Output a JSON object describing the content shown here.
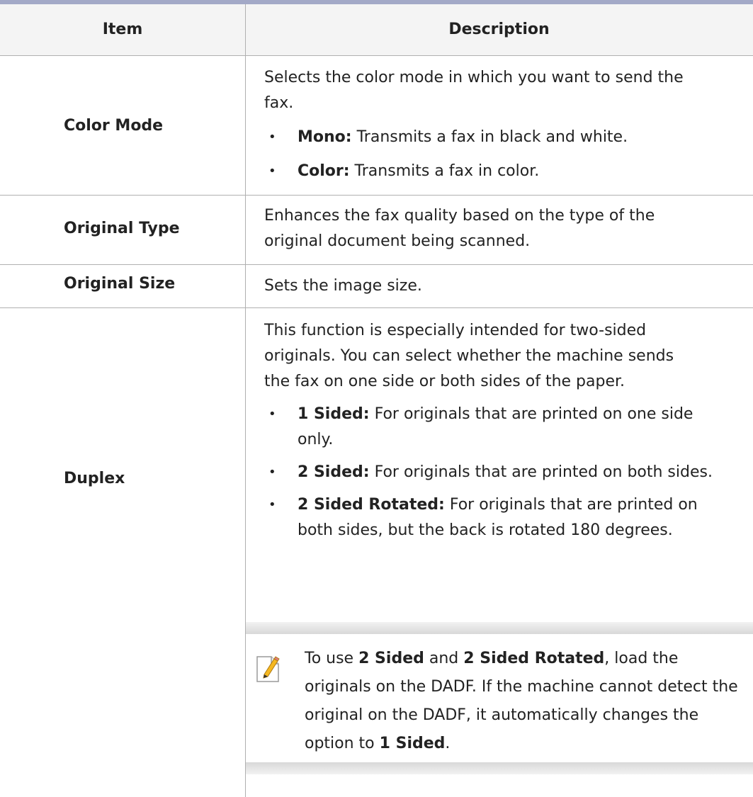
{
  "table": {
    "header": {
      "item": "Item",
      "description": "Description"
    },
    "rows": [
      {
        "item": "Color Mode",
        "desc_line1": "Selects the color mode in which you want to send the",
        "desc_line2": "fax.",
        "bullets": [
          {
            "label": "Mono:",
            "text": " Transmits a fax in black and white."
          },
          {
            "label": "Color:",
            "text": " Transmits a fax in color."
          }
        ]
      },
      {
        "item": "Original Type",
        "desc_line1": "Enhances the fax quality based on the type of the",
        "desc_line2": "original document being scanned."
      },
      {
        "item": "Original Size",
        "desc_line1": "Sets the image size."
      },
      {
        "item": "Duplex",
        "desc_line1": "This function is especially intended for two-sided",
        "desc_line2": "originals. You can select whether the machine sends",
        "desc_line3": "the fax on one side or both sides of the paper.",
        "bullets": [
          {
            "label": "1 Sided:",
            "text": " For originals that are printed on one side",
            "text2": "only."
          },
          {
            "label": "2 Sided:",
            "text": " For originals that are printed on both sides."
          },
          {
            "label": "2 Sided Rotated:",
            "text": " For originals that are printed on",
            "text2": "both sides, but the back is rotated 180 degrees."
          }
        ],
        "note": {
          "icon": "note-pencil-icon",
          "p1": "To use ",
          "b1": "2 Sided",
          "p2": " and ",
          "b2": "2 Sided Rotated",
          "p3": ", load the originals on the DADF. If the machine cannot detect the original on the DADF, it automatically changes the option to ",
          "b3": "1 Sided",
          "p4": "."
        }
      }
    ]
  },
  "colors": {
    "top_rule": "#a3a9c7",
    "header_bg": "#f4f4f4",
    "rule": "#b0b0b0"
  }
}
